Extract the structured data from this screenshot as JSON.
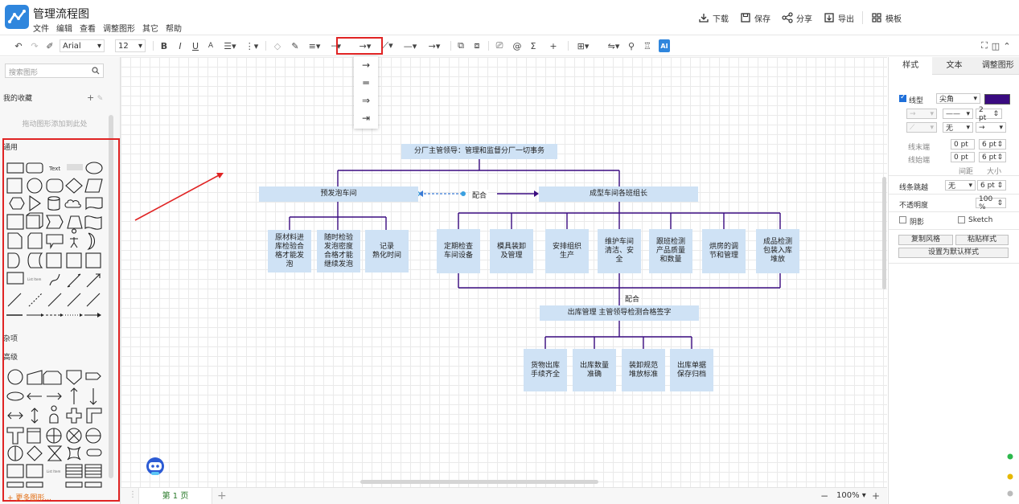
{
  "app": {
    "title": "管理流程图",
    "menu": [
      "文件",
      "编辑",
      "查看",
      "调整图形",
      "其它",
      "帮助"
    ],
    "actions": [
      {
        "icon": "download-icon",
        "label": "下载"
      },
      {
        "icon": "save-icon",
        "label": "保存"
      },
      {
        "icon": "share-icon",
        "label": "分享"
      },
      {
        "icon": "export-icon",
        "label": "导出"
      },
      {
        "icon": "template-icon",
        "label": "模板"
      }
    ]
  },
  "toolbar": {
    "font_family": "Arial",
    "font_size": "12",
    "bold": "B",
    "italic": "I",
    "underline": "U",
    "font_color": "A",
    "sigma": "Σ",
    "plus": "+",
    "ai": "AI",
    "arrow_options": [
      "→",
      "═",
      "⇒",
      "⇥"
    ]
  },
  "left_panel": {
    "search_placeholder": "搜索图形",
    "favorites_title": "我的收藏",
    "favorites_hint": "拖动图形添加到此处",
    "general_title": "通用",
    "misc_title": "杂项",
    "advanced_title": "高级",
    "text_shape": "Text",
    "heading_shape": "Heading",
    "list_item_label": "List Item",
    "more_shapes": "+ 更多图形..."
  },
  "diagram": {
    "root": "分厂主管领导：管理和监督分厂一切事务",
    "left_branch": "预发泡车间",
    "right_branch": "成型车间各班组长",
    "cooperate_label": "配合",
    "left_children": [
      "原材料进\n库检验合\n格才能发\n泡",
      "随时检验\n发泡密度\n合格才能\n继续发泡",
      "记录\n熟化时间"
    ],
    "right_children": [
      "定期检查\n车间设备",
      "模具装卸\n及管理",
      "安排组织\n生产",
      "维护车间\n清洁、安\n全",
      "跟班检测\n产品质量\n和数量",
      "烘房的调\n节和管理",
      "成品检测\n包装入库\n堆放"
    ],
    "cooperate_label_2": "配合",
    "warehouse": "出库管理    主管领导检测合格签字",
    "warehouse_children": [
      "货物出库\n手续齐全",
      "出库数量\n准确",
      "装卸规范\n堆放标准",
      "出库单据\n保存归档"
    ]
  },
  "bottom": {
    "page_tab": "第 1 页",
    "add_page": "+",
    "zoom": "100%",
    "zoom_out": "−",
    "zoom_in": "+"
  },
  "right_panel": {
    "tabs": [
      "样式",
      "文本",
      "调整图形"
    ],
    "line_label": "线型",
    "line_corner": "尖角",
    "line_width": "2 pt",
    "line_end_none": "无",
    "end_label": "线末端",
    "start_label": "线始端",
    "end_value": "0 pt",
    "end_size": "6 pt",
    "start_value": "0 pt",
    "start_size": "6 pt",
    "spacing_label": "间距",
    "size_label": "大小",
    "jump_label": "线条跳越",
    "jump_value": "无",
    "jump_size": "6 pt",
    "opacity_label": "不透明度",
    "opacity_value": "100 %",
    "shadow_label": "阴影",
    "sketch_label": "Sketch",
    "copy_style": "复制风格",
    "paste_style": "粘贴样式",
    "set_default": "设置为默认样式",
    "stroke_color": "#3a0b80"
  },
  "colors": {
    "node_fill": "#cfe2f5",
    "connector": "#3a0b80",
    "highlight": "#e02424",
    "brand": "#2f86dd"
  }
}
